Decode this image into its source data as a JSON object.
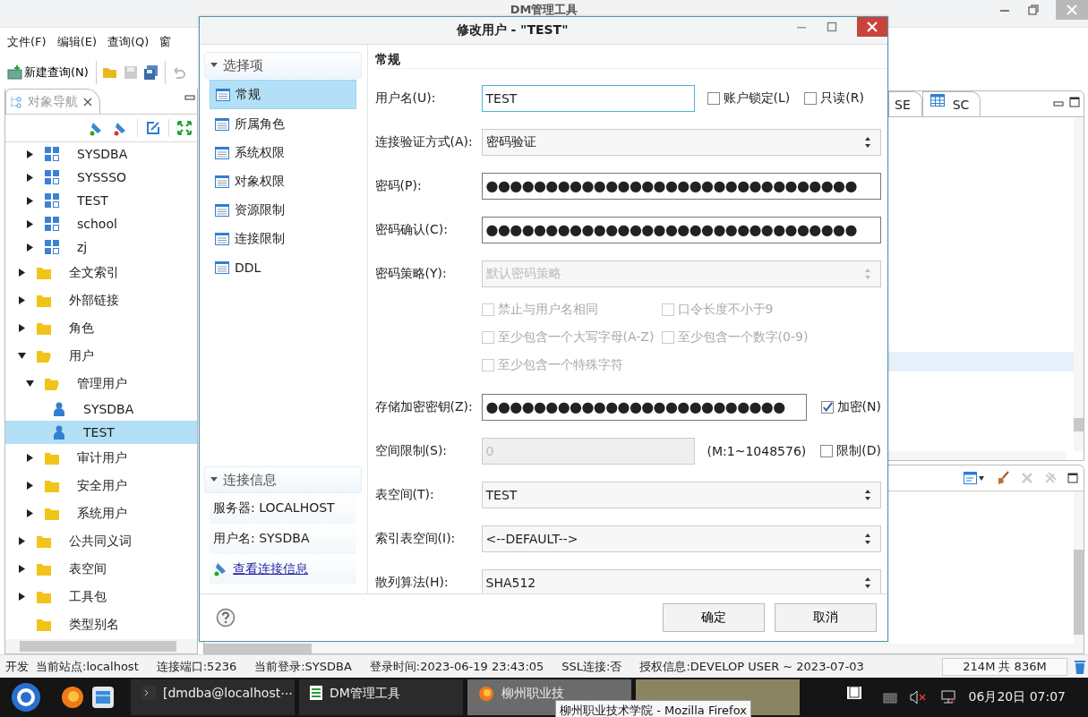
{
  "app": {
    "title": "DM管理工具"
  },
  "menu": [
    {
      "label": "文件(F)"
    },
    {
      "label": "编辑(E)"
    },
    {
      "label": "查询(Q)"
    },
    {
      "label": "窗"
    }
  ],
  "toolbar": {
    "new_query": "新建查询(N)"
  },
  "navigator": {
    "tab": "对象导航",
    "partial_branch": [
      {
        "label": "SYSDBA",
        "kind": "schema",
        "expanded": false,
        "selected": false
      },
      {
        "label": "SYSSSO",
        "kind": "schema",
        "expanded": false,
        "selected": false
      },
      {
        "label": "TEST",
        "kind": "schema",
        "expanded": false,
        "selected": false
      },
      {
        "label": "school",
        "kind": "schema",
        "expanded": false,
        "selected": false
      },
      {
        "label": "zj",
        "kind": "schema",
        "expanded": false,
        "selected": false
      }
    ],
    "tree": [
      {
        "label": "全文索引",
        "kind": "folder",
        "expanded": false,
        "selected": false
      },
      {
        "label": "外部链接",
        "kind": "folder",
        "expanded": false,
        "selected": false
      },
      {
        "label": "角色",
        "kind": "folder",
        "expanded": false,
        "selected": false
      },
      {
        "label": "用户",
        "kind": "folder",
        "expanded": true,
        "selected": false,
        "children": [
          {
            "label": "管理用户",
            "kind": "folder",
            "expanded": true,
            "selected": false,
            "children": [
              {
                "label": "SYSDBA",
                "kind": "user",
                "selected": false
              },
              {
                "label": "TEST",
                "kind": "user",
                "selected": true
              }
            ]
          },
          {
            "label": "审计用户",
            "kind": "folder",
            "expanded": false,
            "selected": false
          },
          {
            "label": "安全用户",
            "kind": "folder",
            "expanded": false,
            "selected": false
          },
          {
            "label": "系统用户",
            "kind": "folder",
            "expanded": false,
            "selected": false
          }
        ]
      },
      {
        "label": "公共同义词",
        "kind": "folder",
        "expanded": false,
        "selected": false
      },
      {
        "label": "表空间",
        "kind": "folder",
        "expanded": false,
        "selected": false
      },
      {
        "label": "工具包",
        "kind": "folder",
        "expanded": false,
        "selected": false
      },
      {
        "label": "类型别名",
        "kind": "folder",
        "selected": false
      }
    ]
  },
  "editor_tabs": [
    {
      "label": "SE",
      "kind": "text"
    },
    {
      "label": "SC",
      "kind": "table"
    }
  ],
  "dialog": {
    "title": "修改用户 - \"TEST\"",
    "options_header": "选择项",
    "options": [
      {
        "label": "常规",
        "selected": true
      },
      {
        "label": "所属角色",
        "selected": false
      },
      {
        "label": "系统权限",
        "selected": false
      },
      {
        "label": "对象权限",
        "selected": false
      },
      {
        "label": "资源限制",
        "selected": false
      },
      {
        "label": "连接限制",
        "selected": false
      },
      {
        "label": "DDL",
        "selected": false
      }
    ],
    "connection_header": "连接信息",
    "connection": [
      {
        "kind": "info",
        "label": "服务器: LOCALHOST"
      },
      {
        "kind": "info",
        "label": "用户名: SYSDBA"
      },
      {
        "kind": "link",
        "label": "查看连接信息"
      }
    ],
    "section": "常规",
    "rows": [
      {
        "kind": "text",
        "label": "用户名(U):",
        "value": "TEST",
        "focused": true,
        "disabled": false,
        "extras": [
          {
            "kind": "checkbox",
            "label": "账户锁定(L)",
            "checked": false
          },
          {
            "kind": "checkbox",
            "label": "只读(R)",
            "checked": false
          }
        ]
      },
      {
        "kind": "select",
        "label": "连接验证方式(A):",
        "value": "密码验证",
        "disabled": false
      },
      {
        "kind": "password",
        "label": "密码(P):",
        "value": "●●●●●●●●●●●●●●●●●●●●●●●●●●●●●●●"
      },
      {
        "kind": "password",
        "label": "密码确认(C):",
        "value": "●●●●●●●●●●●●●●●●●●●●●●●●●●●●●●●"
      },
      {
        "kind": "select",
        "label": "密码策略(Y):",
        "value": "默认密码策略",
        "disabled": true
      },
      {
        "kind": "options",
        "options": [
          {
            "label": "禁止与用户名相同",
            "checked": false,
            "disabled": true
          },
          {
            "label": "口令长度不小于9",
            "checked": false,
            "disabled": true
          },
          {
            "label": "至少包含一个大写字母(A-Z)",
            "checked": false,
            "disabled": true
          },
          {
            "label": "至少包含一个数字(0-9)",
            "checked": false,
            "disabled": true
          },
          {
            "label": "至少包含一个特殊字符",
            "checked": false,
            "disabled": true
          }
        ]
      },
      {
        "kind": "password",
        "label": "存储加密密钥(Z):",
        "value": "●●●●●●●●●●●●●●●●●●●●●●●●●",
        "extras": [
          {
            "kind": "checkbox",
            "label": "加密(N)",
            "checked": true
          }
        ]
      },
      {
        "kind": "text",
        "label": "空间限制(S):",
        "value": "0",
        "focused": false,
        "disabled": true,
        "extras": [
          {
            "kind": "note",
            "label": "(M:1~1048576)"
          },
          {
            "kind": "checkbox",
            "label": "限制(D)",
            "checked": false
          }
        ]
      },
      {
        "kind": "select",
        "label": "表空间(T):",
        "value": "TEST",
        "disabled": false
      },
      {
        "kind": "select",
        "label": "索引表空间(I):",
        "value": "<--DEFAULT-->",
        "disabled": false
      },
      {
        "kind": "select",
        "label": "散列算法(H):",
        "value": "SHA512",
        "disabled": false
      }
    ],
    "buttons": [
      "确定",
      "取消"
    ]
  },
  "status_bar": {
    "mode": "开发",
    "items": [
      "当前站点:localhost",
      "连接端口:5236",
      "当前登录:SYSDBA",
      "登录时间:2023-06-19 23:43:05",
      "SSL连接:否",
      "授权信息:DEVELOP USER ~ 2023-07-03"
    ],
    "memory": "214M 共 836M"
  },
  "taskbar": {
    "tasks": [
      {
        "kind": "terminal",
        "label": "[dmdba@localhost⋯",
        "selected": false,
        "hovered": false
      },
      {
        "kind": "app",
        "label": "DM管理工具",
        "selected": false,
        "hovered": false
      },
      {
        "kind": "browser",
        "label": "柳州职业技",
        "selected": false,
        "hovered": true
      },
      {
        "kind": "hidden",
        "selected": true,
        "hovered": false
      }
    ],
    "tooltip": "柳州职业技术学院 - Mozilla Firefox",
    "clock": "06月20日 07:07"
  }
}
